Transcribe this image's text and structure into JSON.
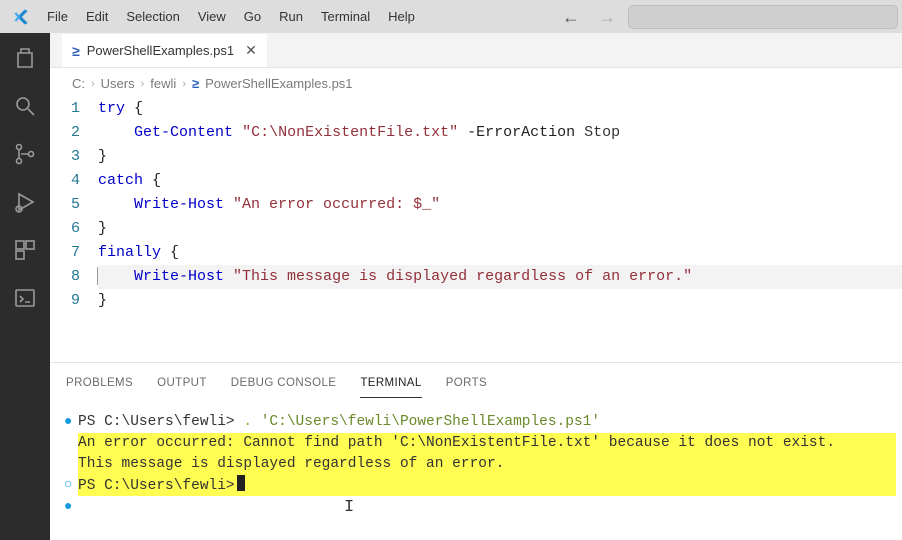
{
  "menu": {
    "file": "File",
    "edit": "Edit",
    "selection": "Selection",
    "view": "View",
    "go": "Go",
    "run": "Run",
    "terminal": "Terminal",
    "help": "Help"
  },
  "tab": {
    "filename": "PowerShellExamples.ps1"
  },
  "breadcrumbs": {
    "p0": "C:",
    "p1": "Users",
    "p2": "fewli",
    "p3": "PowerShellExamples.ps1"
  },
  "gutter": {
    "l1": "1",
    "l2": "2",
    "l3": "3",
    "l4": "4",
    "l5": "5",
    "l6": "6",
    "l7": "7",
    "l8": "8",
    "l9": "9"
  },
  "code": {
    "l1a": "try",
    "l1b": " {",
    "l2a": "    ",
    "l2b": "Get-Content",
    "l2c": " ",
    "l2d": "\"C:\\NonExistentFile.txt\"",
    "l2e": " ",
    "l2f": "-ErrorAction",
    "l2g": " Stop",
    "l3a": "}",
    "l4a": "catch",
    "l4b": " {",
    "l5a": "    ",
    "l5b": "Write-Host",
    "l5c": " ",
    "l5d": "\"An error occurred: $_\"",
    "l6a": "}",
    "l7a": "finally",
    "l7b": " {",
    "l8a": "    ",
    "l8b": "Write-Host",
    "l8c": " ",
    "l8d": "\"This message is displayed regardless of an error.\"",
    "l9a": "}"
  },
  "panel_tabs": {
    "problems": "PROBLEMS",
    "output": "OUTPUT",
    "debug": "DEBUG CONSOLE",
    "terminal": "TERMINAL",
    "ports": "PORTS"
  },
  "terminal": {
    "r1a": "PS C:\\Users\\fewli> ",
    "r1b": ". ",
    "r1c": "'C:\\Users\\fewli\\PowerShellExamples.ps1'",
    "r2": "An error occurred: Cannot find path 'C:\\NonExistentFile.txt' because it does not exist.",
    "r3": "This message is displayed regardless of an error.",
    "r4": "PS C:\\Users\\fewli>"
  }
}
